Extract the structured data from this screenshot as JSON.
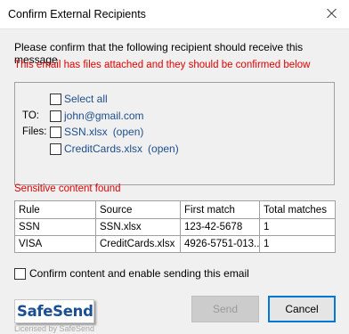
{
  "window": {
    "title": "Confirm External Recipients"
  },
  "message": {
    "confirm_text": "Please confirm that the following recipient should receive this message",
    "attachments_warning": "This email has files attached and they should be confirmed below"
  },
  "recipients": {
    "select_all": "Select all",
    "to_label": "TO:",
    "to_address": "john@gmail.com",
    "files_label": "Files:",
    "files": [
      {
        "name": "SSN.xlsx",
        "open": "(open)"
      },
      {
        "name": "CreditCards.xlsx",
        "open": "(open)"
      }
    ]
  },
  "sensitive": {
    "label": "Sensitive content found",
    "columns": [
      "Rule",
      "Source",
      "First match",
      "Total matches"
    ],
    "rows": [
      [
        "SSN",
        "SSN.xlsx",
        "123-42-5678",
        "1"
      ],
      [
        "VISA",
        "CreditCards.xlsx",
        "4926-5751-013...",
        "1"
      ]
    ]
  },
  "confirm_checkbox": "Confirm content and enable sending this email",
  "logo": {
    "text": "SafeSend",
    "licensed": "Licensed by SafeSend"
  },
  "buttons": {
    "send": "Send",
    "cancel": "Cancel"
  },
  "colors": {
    "warning_red": "#e00000",
    "link_blue": "#1f4e8c",
    "focus_blue": "#0078d7",
    "logo_blue": "#1b4f94"
  }
}
